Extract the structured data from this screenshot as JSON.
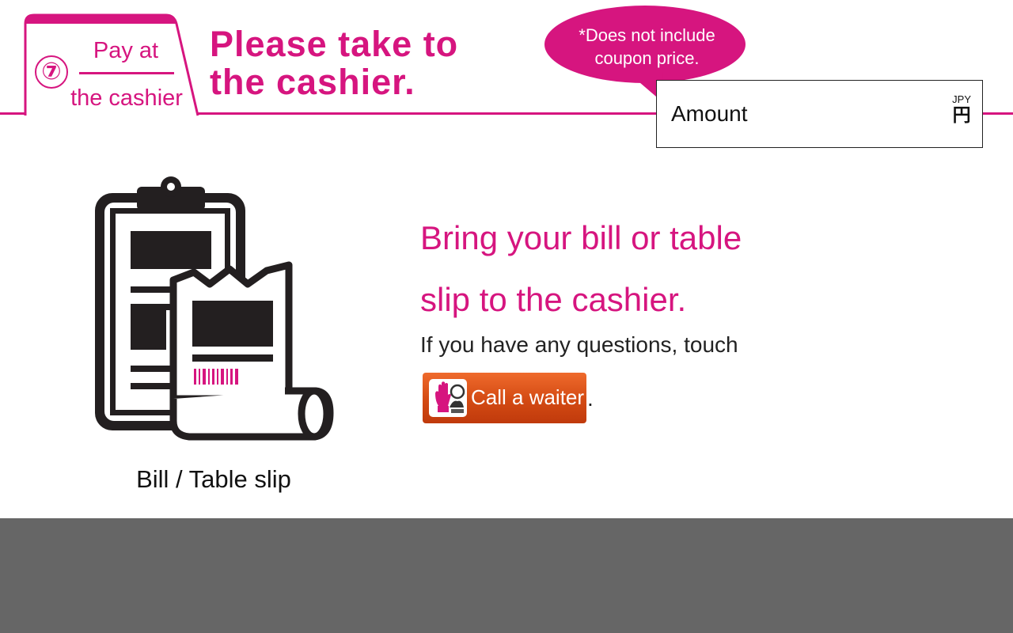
{
  "header": {
    "step_number": "⑦",
    "step_line1": "Pay at",
    "step_line2": "the cashier",
    "headline_line1": "Please take to",
    "headline_line2": "the cashier.",
    "bubble_line1": "*Does not include",
    "bubble_line2": "coupon price."
  },
  "amount": {
    "label": "Amount",
    "currency_code": "JPY",
    "currency_symbol": "円"
  },
  "illustration": {
    "icon": "bill-clipboard-icon",
    "caption": "Bill / Table slip"
  },
  "instructions": {
    "line1": "Bring your bill or table",
    "line2": "slip to the cashier.",
    "hint": "If you have any questions, touch",
    "trailing": "."
  },
  "waiter_button": {
    "label": "Call a waiter",
    "icon": "hand-waiter-icon"
  },
  "colors": {
    "accent": "#d6157f",
    "button": "#d34a13",
    "footer": "#666666"
  }
}
